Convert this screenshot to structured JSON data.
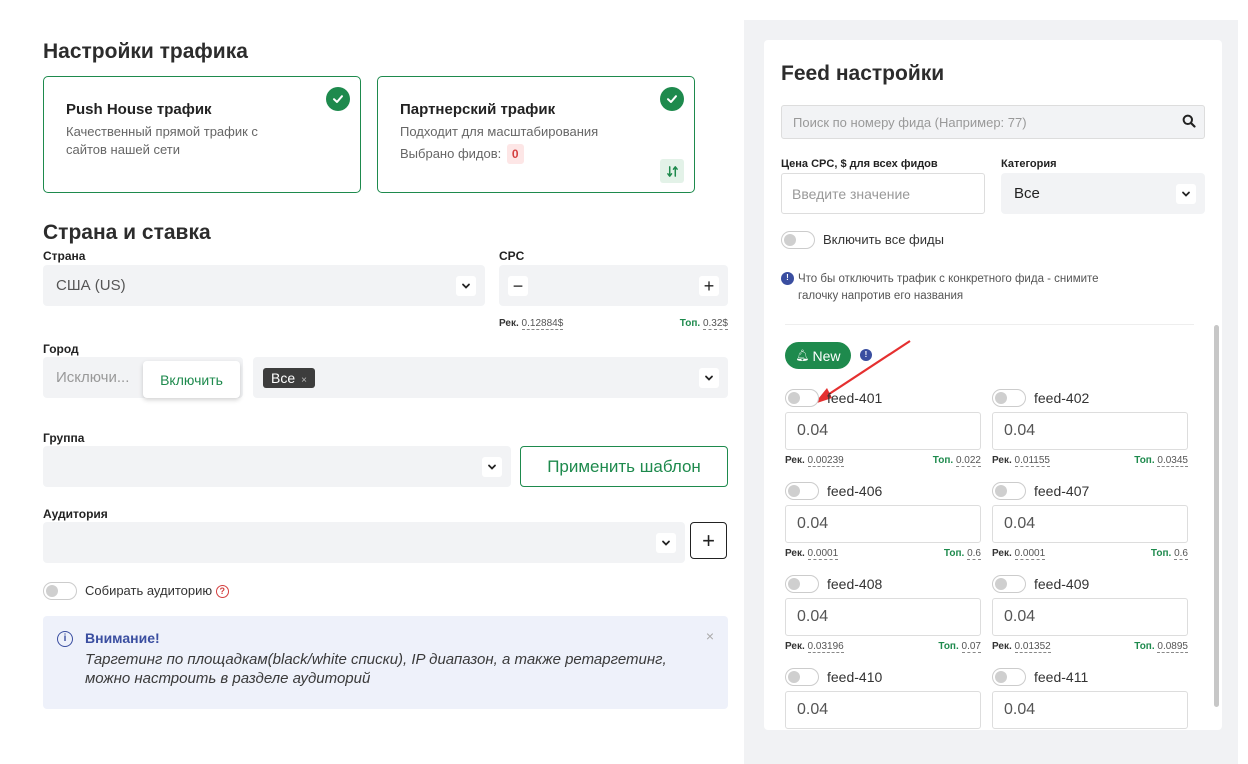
{
  "traffic": {
    "title": "Настройки трафика",
    "push": {
      "title": "Push House трафик",
      "desc1": "Качественный прямой трафик с",
      "desc2": "сайтов нашей сети"
    },
    "partner": {
      "title": "Партнерский трафик",
      "desc": "Подходит для масштабирования",
      "selected_label": "Выбрано фидов:",
      "selected_count": "0"
    }
  },
  "country_rate": {
    "title": "Страна и ставка",
    "country_label": "Страна",
    "country_value": "США (US)",
    "cpc_label": "CPC",
    "minus": "−",
    "plus": "+",
    "rec_label": "Рек.",
    "rec_value": "0.12884$",
    "top_label": "Топ.",
    "top_value": "0.32$"
  },
  "city": {
    "label": "Город",
    "exclude": "Исключи...",
    "include": "Включить",
    "tag": "Все",
    "tag_close": "×"
  },
  "group": {
    "label": "Группа",
    "apply": "Применить шаблон"
  },
  "audience": {
    "label": "Аудитория",
    "add": "+",
    "collect": "Собирать аудиторию",
    "help": "?"
  },
  "alert": {
    "icon": "i",
    "title": "Внимание!",
    "line1": "Таргетинг по площадкам(black/white списки), IP диапазон, а также ретаргетинг,",
    "line2": "можно настроить в разделе аудиторий",
    "close": "×"
  },
  "feed": {
    "title": "Feed настройки",
    "search_placeholder": "Поиск по номеру фида (Например: 77)",
    "cpc_label": "Цена CPC, $ для всех фидов",
    "cpc_placeholder": "Введите значение",
    "category_label": "Категория",
    "category_value": "Все",
    "include_all": "Включить все фиды",
    "hint1": "Что бы отключить трафик с конкретного фида - снимите",
    "hint2": "галочку напротив его названия",
    "new_label": "New",
    "rec_label": "Рек.",
    "top_label": "Топ.",
    "feeds": [
      {
        "name": "feed-401",
        "value": "0.04",
        "rec": "0.00239",
        "top": "0.022"
      },
      {
        "name": "feed-402",
        "value": "0.04",
        "rec": "0.01155",
        "top": "0.0345"
      },
      {
        "name": "feed-406",
        "value": "0.04",
        "rec": "0.0001",
        "top": "0.6"
      },
      {
        "name": "feed-407",
        "value": "0.04",
        "rec": "0.0001",
        "top": "0.6"
      },
      {
        "name": "feed-408",
        "value": "0.04",
        "rec": "0.03196",
        "top": "0.07"
      },
      {
        "name": "feed-409",
        "value": "0.04",
        "rec": "0.01352",
        "top": "0.0895"
      },
      {
        "name": "feed-410",
        "value": "0.04"
      },
      {
        "name": "feed-411",
        "value": "0.04"
      }
    ]
  },
  "colors": {
    "accent": "#1e8a4d",
    "info": "#3a4ea0",
    "danger": "#d43f3f",
    "arrow": "#e53030"
  }
}
